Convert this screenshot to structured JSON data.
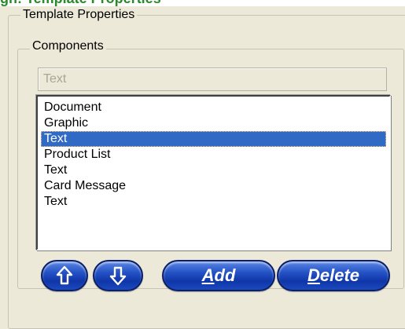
{
  "header_fragment": "gn: Template Properties",
  "template_properties": {
    "legend": "Template Properties",
    "components": {
      "legend": "Components",
      "selected_text": "Text",
      "items": [
        {
          "label": "Document"
        },
        {
          "label": "Graphic"
        },
        {
          "label": "Text",
          "selected": true
        },
        {
          "label": "Product List"
        },
        {
          "label": "Text"
        },
        {
          "label": "Card Message"
        },
        {
          "label": "Text"
        }
      ]
    },
    "buttons": {
      "move_up_icon": "up-arrow-icon",
      "move_down_icon": "down-arrow-icon",
      "add_label_mnemonic": "A",
      "add_label_rest": "dd",
      "delete_label_mnemonic": "D",
      "delete_label_rest": "elete"
    }
  },
  "colors": {
    "selection": "#316ac5",
    "button_blue": "#2351c4",
    "dialog_bg": "#ece9d8"
  }
}
